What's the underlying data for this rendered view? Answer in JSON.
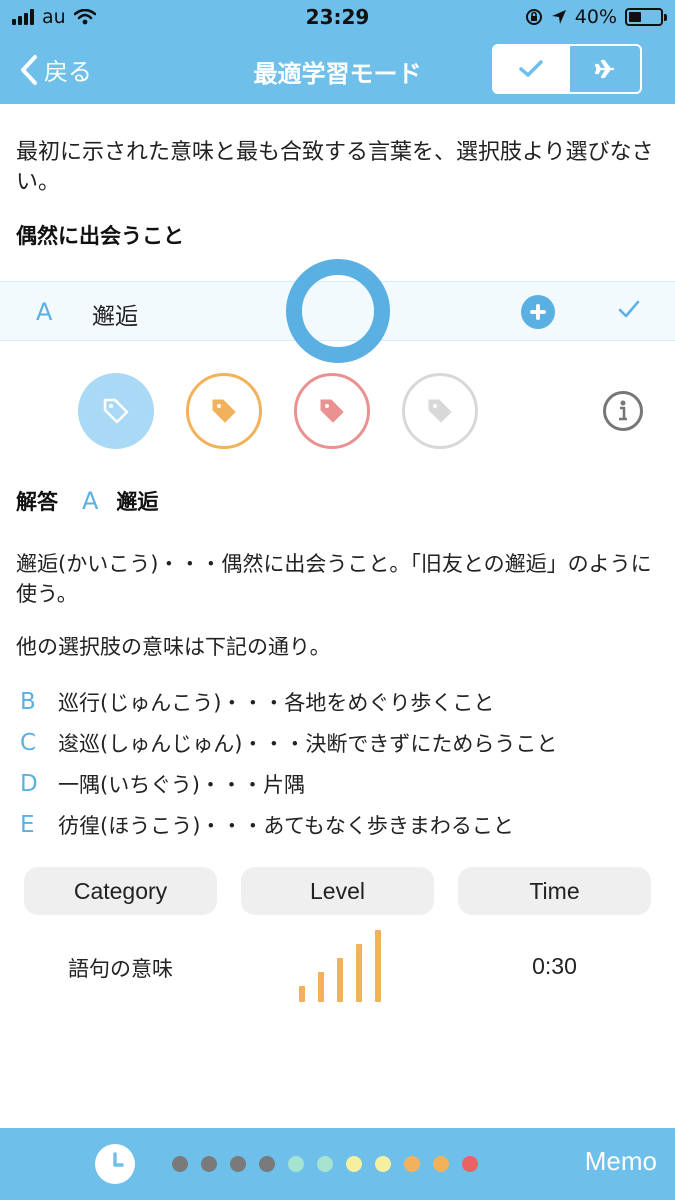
{
  "status_bar": {
    "carrier": "au",
    "time": "23:29",
    "battery": "40%",
    "battery_level": 0.4
  },
  "navbar": {
    "back_label": "戻る",
    "title": "最適学習モード",
    "segments": [
      "check-icon",
      "airplane-icon"
    ]
  },
  "question": {
    "instruction": "最初に示された意味と最も合致する言葉を、選択肢より選びなさい。",
    "prompt": "偶然に出会うこと"
  },
  "selected_answer": {
    "letter": "A",
    "word": "邂逅",
    "result": "correct"
  },
  "tags": [
    {
      "name": "tag-blue",
      "color": "#5aafe3",
      "selected": true
    },
    {
      "name": "tag-orange",
      "color": "#f2b25c",
      "selected": false
    },
    {
      "name": "tag-red",
      "color": "#ea9191",
      "selected": false
    },
    {
      "name": "tag-gray",
      "color": "#d8d8d8",
      "selected": false
    }
  ],
  "solution": {
    "label": "解答",
    "letter": "A",
    "word": "邂逅",
    "explanation": "邂逅(かいこう)・・・偶然に出会うこと。「旧友との邂逅」のように使う。",
    "others_intro": "他の選択肢の意味は下記の通り。",
    "options": [
      {
        "letter": "B",
        "text": "巡行(じゅんこう)・・・各地をめぐり歩くこと"
      },
      {
        "letter": "C",
        "text": "逡巡(しゅんじゅん)・・・決断できずにためらうこと"
      },
      {
        "letter": "D",
        "text": "一隅(いちぐう)・・・片隅"
      },
      {
        "letter": "E",
        "text": "彷徨(ほうこう)・・・あてもなく歩きまわること"
      }
    ]
  },
  "stats": {
    "headers": {
      "category": "Category",
      "level": "Level",
      "time": "Time"
    },
    "category": "語句の意味",
    "level": 5,
    "level_max": 5,
    "time": "0:30"
  },
  "bottom_bar": {
    "memo_label": "Memo",
    "progress_dots": [
      "#7a7a7a",
      "#7a7a7a",
      "#7a7a7a",
      "#7a7a7a",
      "#a6e3d0",
      "#a6e3d0",
      "#f5f0a0",
      "#f5f0a0",
      "#f2b25c",
      "#f2b25c",
      "#ea6262"
    ]
  },
  "colors": {
    "accent": "#5aafe3",
    "header": "#6ebfe9",
    "level_bar": "#f2b25c"
  }
}
